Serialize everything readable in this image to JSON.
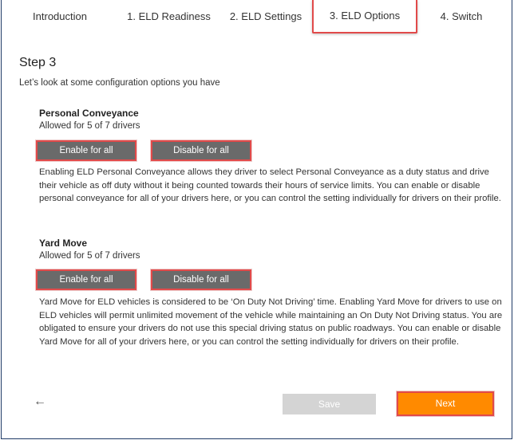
{
  "tabs": [
    {
      "label": "Introduction"
    },
    {
      "label": "1. ELD Readiness"
    },
    {
      "label": "2. ELD Settings"
    },
    {
      "label": "3. ELD Options",
      "active": true
    },
    {
      "label": "4. Switch"
    }
  ],
  "step_title": "Step 3",
  "intro": "Let’s look at some configuration options you have",
  "personal_conveyance": {
    "title": "Personal Conveyance",
    "allowed": "Allowed for 5 of 7 drivers",
    "enable_label": "Enable for all",
    "disable_label": "Disable for all",
    "description": "Enabling ELD Personal Conveyance allows they driver to select Personal Conveyance as a duty status and drive their vehicle as off duty without it being counted towards their hours of service limits. You can enable or disable personal conveyance for all of your drivers here, or you can control the setting individually for drivers on their profile."
  },
  "yard_move": {
    "title": "Yard Move",
    "allowed": "Allowed for 5 of 7 drivers",
    "enable_label": "Enable for all",
    "disable_label": "Disable for all",
    "description": "Yard Move for ELD vehicles is considered to be ‘On Duty Not Driving’ time. Enabling Yard Move for drivers to use on ELD vehicles will permit unlimited movement of the vehicle while maintaining an On Duty Not Driving status. You are obligated to ensure your drivers do not use this special driving status on public roadways. You can enable or disable Yard Move for all of your drivers here, or you can control the setting individually for drivers on their profile."
  },
  "footer": {
    "back_icon": "←",
    "save_label": "Save",
    "next_label": "Next"
  },
  "colors": {
    "accent": "#ff8a00",
    "highlight": "#e14a4a",
    "button_gray": "#6a6a6a",
    "disabled": "#d4d4d4"
  }
}
